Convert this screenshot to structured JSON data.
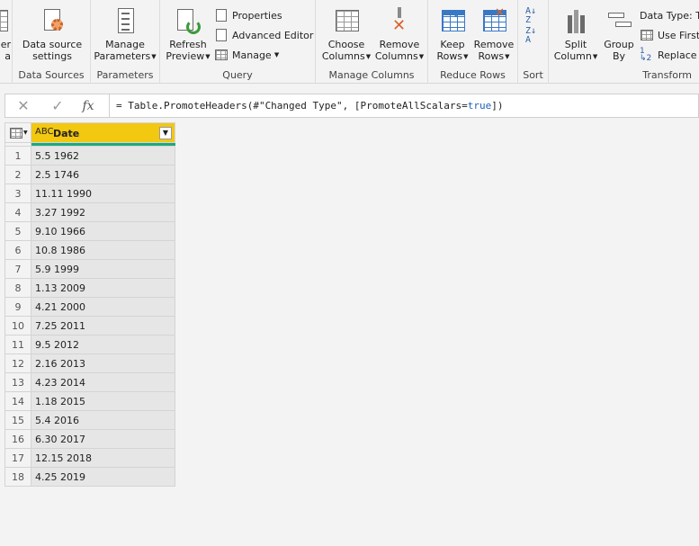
{
  "ribbon": {
    "groups": {
      "data_sources": "Data Sources",
      "parameters": "Parameters",
      "query": "Query",
      "manage_columns": "Manage Columns",
      "reduce_rows": "Reduce Rows",
      "sort": "Sort",
      "transform": "Transform"
    },
    "buttons": {
      "enter_data_l1": "er",
      "enter_data_l2": "a",
      "data_source_settings_l1": "Data source",
      "data_source_settings_l2": "settings",
      "manage_parameters_l1": "Manage",
      "manage_parameters_l2": "Parameters",
      "refresh_preview_l1": "Refresh",
      "refresh_preview_l2": "Preview",
      "properties": "Properties",
      "advanced_editor": "Advanced Editor",
      "manage": "Manage",
      "choose_columns_l1": "Choose",
      "choose_columns_l2": "Columns",
      "remove_columns_l1": "Remove",
      "remove_columns_l2": "Columns",
      "keep_rows_l1": "Keep",
      "keep_rows_l2": "Rows",
      "remove_rows_l1": "Remove",
      "remove_rows_l2": "Rows",
      "split_column_l1": "Split",
      "split_column_l2": "Column",
      "group_by_l1": "Group",
      "group_by_l2": "By",
      "data_type": "Data Type: Te",
      "use_first_row": "Use First",
      "replace_values": "Replace V"
    }
  },
  "formula_bar": {
    "cancel_glyph": "✕",
    "commit_glyph": "✓",
    "fx_glyph": "fx",
    "formula_prefix": "= Table.PromoteHeaders(#\"Changed Type\", [PromoteAllScalars=",
    "formula_true": "true",
    "formula_suffix": "])"
  },
  "table": {
    "column_type_icon": "ABC",
    "column_header": "Date",
    "rows": [
      {
        "n": "1",
        "date": "5.5 1962"
      },
      {
        "n": "2",
        "date": "2.5 1746"
      },
      {
        "n": "3",
        "date": "11.11 1990"
      },
      {
        "n": "4",
        "date": "3.27 1992"
      },
      {
        "n": "5",
        "date": "9.10 1966"
      },
      {
        "n": "6",
        "date": "10.8 1986"
      },
      {
        "n": "7",
        "date": "5.9 1999"
      },
      {
        "n": "8",
        "date": "1.13 2009"
      },
      {
        "n": "9",
        "date": "4.21 2000"
      },
      {
        "n": "10",
        "date": "7.25 2011"
      },
      {
        "n": "11",
        "date": "9.5 2012"
      },
      {
        "n": "12",
        "date": "2.16 2013"
      },
      {
        "n": "13",
        "date": "4.23 2014"
      },
      {
        "n": "14",
        "date": "1.18 2015"
      },
      {
        "n": "15",
        "date": "5.4 2016"
      },
      {
        "n": "16",
        "date": "6.30 2017"
      },
      {
        "n": "17",
        "date": "12.15 2018"
      },
      {
        "n": "18",
        "date": "4.25 2019"
      }
    ]
  },
  "colors": {
    "header_accent": "#f2c811",
    "quality_bar": "#1aa97c",
    "keyword_blue": "#1f5fbf"
  }
}
